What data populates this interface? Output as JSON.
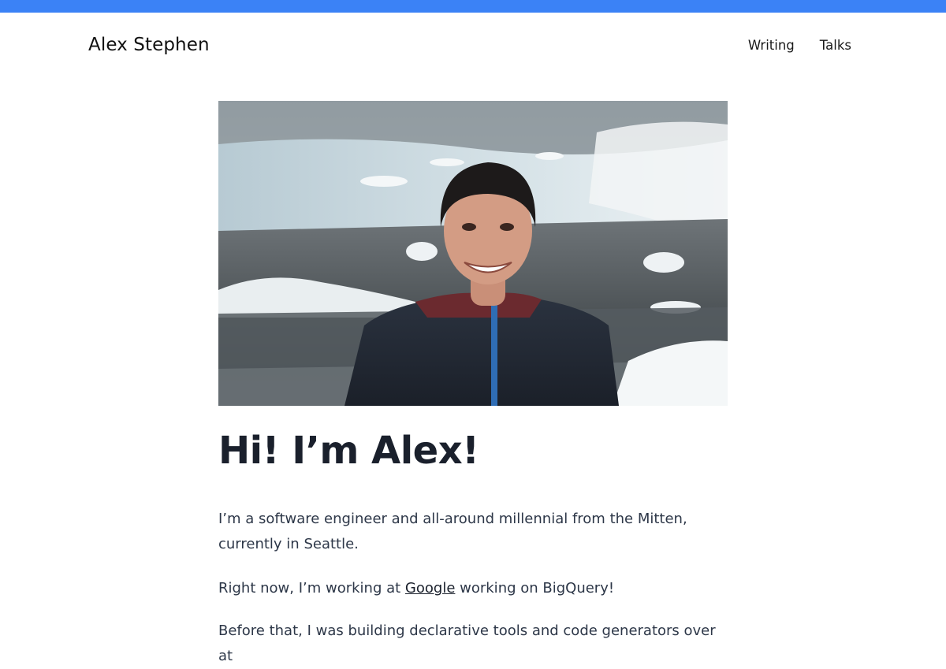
{
  "colors": {
    "accent": "#3b82f6",
    "heading": "#1a202c",
    "body_text": "#2d3748"
  },
  "header": {
    "site_title": "Alex Stephen",
    "nav": [
      {
        "label": "Writing"
      },
      {
        "label": "Talks"
      }
    ]
  },
  "hero": {
    "alt_subject": "portrait-photo"
  },
  "main": {
    "heading": "Hi! I’m Alex!",
    "paragraph1": "I’m a software engineer and all-around millennial from the Mitten, currently in Seattle.",
    "paragraph2": {
      "before": "Right now, I’m working at ",
      "link": "Google",
      "after": " working on BigQuery!"
    },
    "paragraph3": "Before that, I was building declarative tools and code generators over at"
  }
}
